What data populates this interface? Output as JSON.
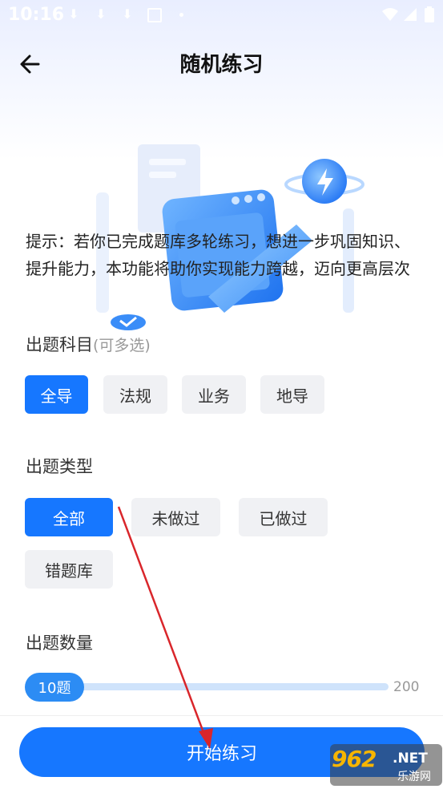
{
  "status_bar": {
    "time": "10:16"
  },
  "header": {
    "title": "随机练习"
  },
  "hint": {
    "text": "提示：若你已完成题库多轮练习，想进一步巩固知识、提升能力，本功能将助你实现能力跨越，迈向更高层次"
  },
  "subject_section": {
    "label": "出题科目",
    "sub_label": "(可多选)",
    "options": [
      "全导",
      "法规",
      "业务",
      "地导"
    ],
    "selected": "全导"
  },
  "type_section": {
    "label": "出题类型",
    "options": [
      "全部",
      "未做过",
      "已做过",
      "错题库"
    ],
    "selected": "全部"
  },
  "count_section": {
    "label": "出题数量",
    "value_label": "10题",
    "max_label": "200",
    "value": 10,
    "max": 200
  },
  "start_button": {
    "label": "开始练习"
  },
  "watermark": {
    "brand": "962",
    "suffix": ".NET",
    "sub": "乐游网"
  },
  "colors": {
    "primary": "#1677ff",
    "chip_bg": "#f0f1f4",
    "slider_track": "#cfe3fb",
    "arrow": "#d9262b"
  }
}
